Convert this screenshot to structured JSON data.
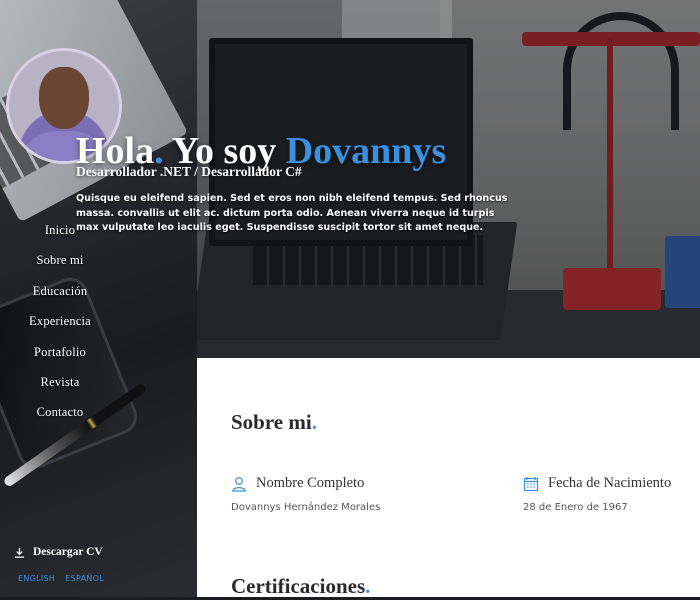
{
  "sidebar": {
    "nav": [
      {
        "label": "Inicio"
      },
      {
        "label": "Sobre mi"
      },
      {
        "label": "Educación"
      },
      {
        "label": "Experiencia"
      },
      {
        "label": "Portafolio"
      },
      {
        "label": "Revista"
      },
      {
        "label": "Contacto"
      }
    ],
    "download_label": "Descargar CV",
    "languages": [
      "ENGLISH",
      "ESPAÑOL"
    ]
  },
  "hero": {
    "greeting": "Hola",
    "greeting_dot": ".",
    "intro": " Yo soy ",
    "name": "Dovannys",
    "subtitle": "Desarrollador .NET / Desarrollador C#",
    "text": "Quisque eu eleifend sapien. Sed et eros non nibh eleifend tempus. Sed rhoncus massa. convallis ut elit ac. dictum porta odio. Aenean viverra neque id turpis max vulputate leo iaculis eget. Suspendisse suscipit tortor sit amet neque."
  },
  "about": {
    "title": "Sobre mi",
    "title_dot": ".",
    "full_name_label": "Nombre Completo",
    "full_name_value": "Dovannys Hernández Morales",
    "birth_label": "Fecha de Nacimiento",
    "birth_value": "28 de Enero de 1967"
  },
  "certifications": {
    "title": "Certificaciones",
    "title_dot": "."
  },
  "colors": {
    "accent": "#3a8fe0",
    "sidebar_bg": "#24262b"
  },
  "icons": {
    "download": "download-icon",
    "user": "user-icon",
    "calendar": "calendar-icon"
  }
}
